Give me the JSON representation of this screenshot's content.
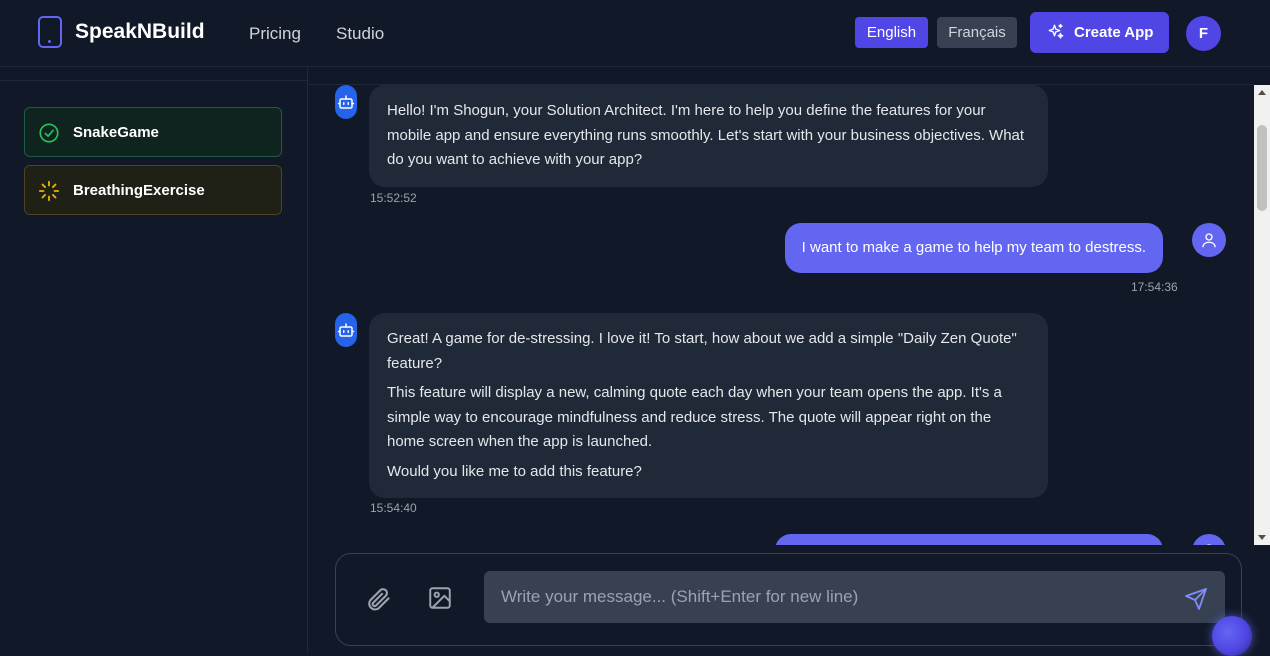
{
  "header": {
    "brand": "SpeakNBuild",
    "nav": [
      "Pricing",
      "Studio"
    ],
    "languages": {
      "english": "English",
      "french": "Français"
    },
    "create_app_label": "Create App",
    "avatar_initial": "F"
  },
  "sidebar": {
    "projects": [
      {
        "name": "SnakeGame",
        "status": "done"
      },
      {
        "name": "BreathingExercise",
        "status": "building"
      }
    ]
  },
  "chat": {
    "messages": [
      {
        "role": "assistant",
        "paragraphs": [
          "Hello! I'm Shogun, your Solution Architect. I'm here to help you define the features for your mobile app and ensure everything runs smoothly. Let's start with your business objectives. What do you want to achieve with your app?"
        ],
        "time": "15:52:52"
      },
      {
        "role": "user",
        "text": "I want to make a game to help my team to destress.",
        "time": "17:54:36"
      },
      {
        "role": "assistant",
        "paragraphs": [
          "Great! A game for de-stressing. I love it! To start, how about we add a simple \"Daily Zen Quote\" feature?",
          "This feature will display a new, calming quote each day when your team opens the app. It's a simple way to encourage mindfulness and reduce stress. The quote will appear right on the home screen when the app is launched.",
          "Would you like me to add this feature?"
        ],
        "time": "15:54:40"
      }
    ],
    "input_placeholder": "Write your message... (Shift+Enter for new line)"
  },
  "colors": {
    "accent": "#4f46e5",
    "user_bubble": "#6366f1",
    "bot_bubble": "#1f2937",
    "bot_avatar": "#2563eb",
    "success": "#22c55e",
    "warning": "#eab308"
  },
  "icons": [
    "phone-logo-icon",
    "sparkles-icon",
    "check-circle-icon",
    "loader-icon",
    "bot-icon",
    "user-icon",
    "paperclip-icon",
    "image-icon",
    "send-icon"
  ]
}
